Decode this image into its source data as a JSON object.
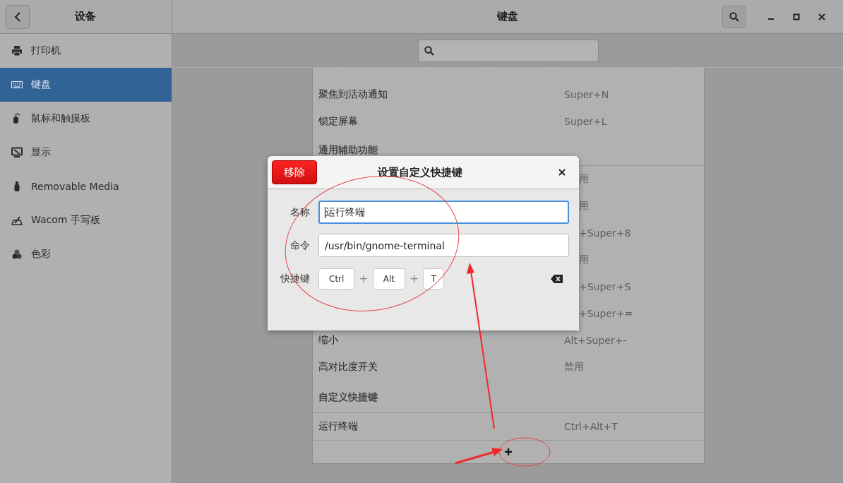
{
  "window": {
    "title": "键盘"
  },
  "sidebar": {
    "title": "设备",
    "items": [
      {
        "label": "打印机",
        "kind": "printer",
        "selected": false
      },
      {
        "label": "键盘",
        "kind": "keyboard",
        "selected": true
      },
      {
        "label": "鼠标和触摸板",
        "kind": "mouse",
        "selected": false
      },
      {
        "label": "显示",
        "kind": "display",
        "selected": false
      },
      {
        "label": "Removable Media",
        "kind": "usb",
        "selected": false
      },
      {
        "label": "Wacom 手写板",
        "kind": "tablet",
        "selected": false
      },
      {
        "label": "色彩",
        "kind": "color",
        "selected": false
      }
    ]
  },
  "shortcuts": [
    {
      "kind": "row",
      "label": "聚焦到活动通知",
      "shortcut": "Super+N"
    },
    {
      "kind": "row",
      "label": "锁定屏幕",
      "shortcut": "Super+L"
    },
    {
      "kind": "heading",
      "label": "通用辅助功能"
    },
    {
      "kind": "covered",
      "shortcut": "用"
    },
    {
      "kind": "covered",
      "shortcut": "用"
    },
    {
      "kind": "covered",
      "shortcut": "+Super+8"
    },
    {
      "kind": "covered",
      "shortcut": "用"
    },
    {
      "kind": "covered",
      "shortcut": "+Super+S"
    },
    {
      "kind": "covered",
      "shortcut": "+Super+="
    },
    {
      "kind": "row",
      "label": "缩小",
      "shortcut": "Alt+Super+-"
    },
    {
      "kind": "row",
      "label": "高对比度开关",
      "shortcut": "禁用"
    },
    {
      "kind": "heading",
      "label": "自定义快捷键"
    },
    {
      "kind": "row",
      "label": "运行终端",
      "shortcut": "Ctrl+Alt+T"
    },
    {
      "kind": "add",
      "label": "+"
    }
  ],
  "dialog": {
    "title": "设置自定义快捷键",
    "remove_button": "移除",
    "fields": [
      {
        "label": "名称",
        "value": "运行终端",
        "focused": true
      },
      {
        "label": "命令",
        "value": "/usr/bin/gnome-terminal",
        "focused": false
      }
    ],
    "shortcut_label": "快捷键",
    "keys": [
      {
        "kind": "key",
        "label": "Ctrl"
      },
      {
        "kind": "plus",
        "label": "+"
      },
      {
        "kind": "key",
        "label": "Alt"
      },
      {
        "kind": "plus",
        "label": "+"
      },
      {
        "kind": "key",
        "label": "T"
      }
    ]
  }
}
